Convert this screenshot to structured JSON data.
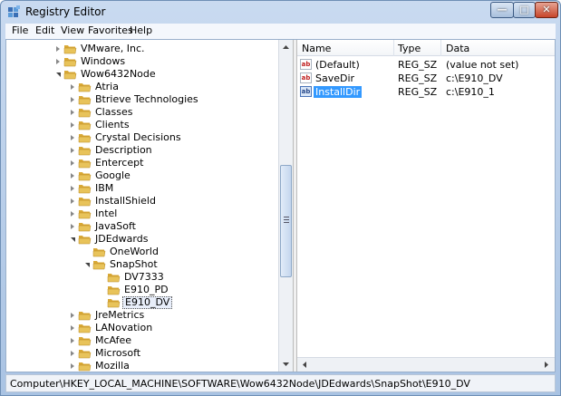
{
  "window": {
    "title": "Registry Editor"
  },
  "menu": [
    "File",
    "Edit",
    "View",
    "Favorites",
    "Help"
  ],
  "tree": [
    {
      "label": "VMware, Inc.",
      "expander": "closed"
    },
    {
      "label": "Windows",
      "expander": "closed"
    },
    {
      "label": "Wow6432Node",
      "expander": "open"
    },
    {
      "label": "Atria",
      "expander": "closed"
    },
    {
      "label": "Btrieve Technologies",
      "expander": "closed"
    },
    {
      "label": "Classes",
      "expander": "closed"
    },
    {
      "label": "Clients",
      "expander": "closed"
    },
    {
      "label": "Crystal Decisions",
      "expander": "closed"
    },
    {
      "label": "Description",
      "expander": "closed"
    },
    {
      "label": "Entercept",
      "expander": "closed"
    },
    {
      "label": "Google",
      "expander": "closed"
    },
    {
      "label": "IBM",
      "expander": "closed"
    },
    {
      "label": "InstallShield",
      "expander": "closed"
    },
    {
      "label": "Intel",
      "expander": "closed"
    },
    {
      "label": "JavaSoft",
      "expander": "closed"
    },
    {
      "label": "JDEdwards",
      "expander": "open"
    },
    {
      "label": "OneWorld",
      "expander": "none"
    },
    {
      "label": "SnapShot",
      "expander": "open"
    },
    {
      "label": "DV7333",
      "expander": "none"
    },
    {
      "label": "E910_PD",
      "expander": "none"
    },
    {
      "label": "E910_DV",
      "expander": "none",
      "selected": true
    },
    {
      "label": "JreMetrics",
      "expander": "closed"
    },
    {
      "label": "LANovation",
      "expander": "closed"
    },
    {
      "label": "McAfee",
      "expander": "closed"
    },
    {
      "label": "Microsoft",
      "expander": "closed"
    },
    {
      "label": "Mozilla",
      "expander": "closed"
    }
  ],
  "list": {
    "columns": [
      "Name",
      "Type",
      "Data"
    ],
    "rows": [
      {
        "name": "(Default)",
        "type": "REG_SZ",
        "data": "(value not set)",
        "icon": "ab"
      },
      {
        "name": "SaveDir",
        "type": "REG_SZ",
        "data": "c:\\E910_DV",
        "icon": "ab"
      },
      {
        "name": "InstallDir",
        "type": "REG_SZ",
        "data": "c:\\E910_1",
        "icon": "ab",
        "selected": true
      }
    ]
  },
  "status": {
    "path": "Computer\\HKEY_LOCAL_MACHINE\\SOFTWARE\\Wow6432Node\\JDEdwards\\SnapShot\\E910_DV"
  },
  "colors": {
    "folder": "#e8c35a",
    "selection": "#3399ff",
    "frame": "#a9c3e3"
  }
}
